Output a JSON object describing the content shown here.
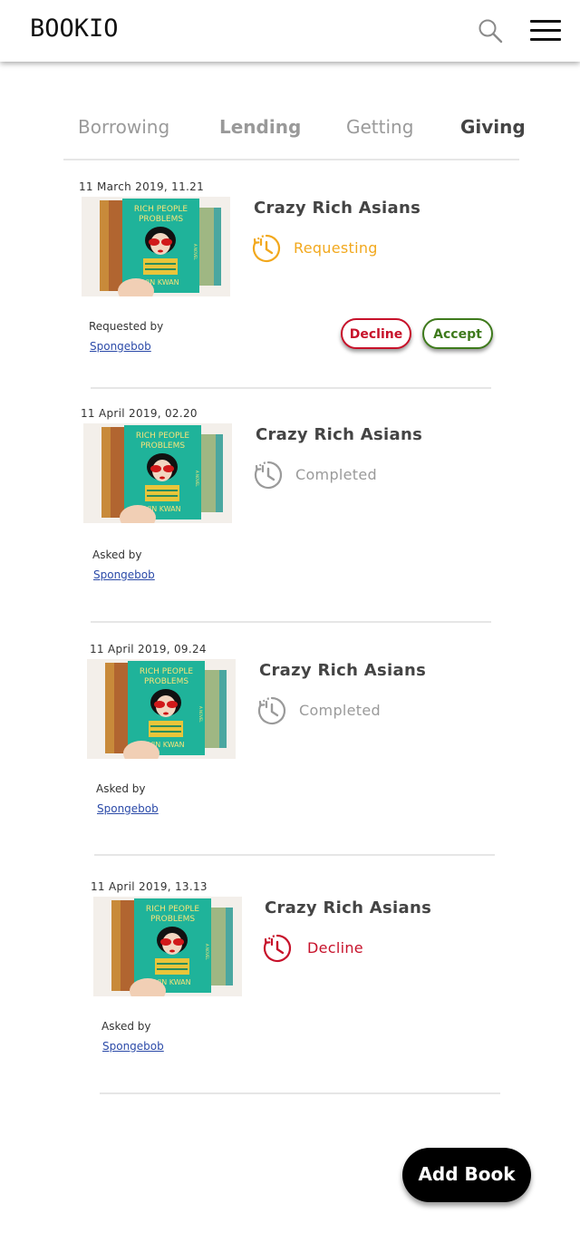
{
  "app": {
    "logo": "BOOKIO"
  },
  "tabs": [
    {
      "label": "Borrowing"
    },
    {
      "label": "Lending"
    },
    {
      "label": "Getting"
    },
    {
      "label": "Giving"
    }
  ],
  "cards": [
    {
      "date": "11 March 2019, 11.21",
      "book_title": "Crazy Rich Asians",
      "status": "Requesting",
      "status_color": "#f2a81d",
      "by_label": "Requested by",
      "by_user": "Spongebob",
      "decline_label": "Decline",
      "accept_label": "Accept"
    },
    {
      "date": "11 April 2019, 02.20",
      "book_title": "Crazy Rich Asians",
      "status": "Completed",
      "status_color": "#9a9a9a",
      "by_label": "Asked by",
      "by_user": "Spongebob"
    },
    {
      "date": "11 April 2019, 09.24",
      "book_title": "Crazy Rich Asians",
      "status": "Completed",
      "status_color": "#9a9a9a",
      "by_label": "Asked by",
      "by_user": "Spongebob"
    },
    {
      "date": "11 April 2019, 13.13",
      "book_title": "Crazy Rich Asians",
      "status": "Decline",
      "status_color": "#c7112a",
      "by_label": "Asked by",
      "by_user": "Spongebob"
    }
  ],
  "book_cover": {
    "title_line1": "RICH PEOPLE",
    "title_line2": "PROBLEMS",
    "author": "VIN KWAN",
    "side_text": "A NOVEL"
  },
  "actions": {
    "add_book_label": "Add Book"
  },
  "icons": {
    "search": "search-icon",
    "menu": "hamburger-menu-icon",
    "status": "clock-history-icon"
  }
}
